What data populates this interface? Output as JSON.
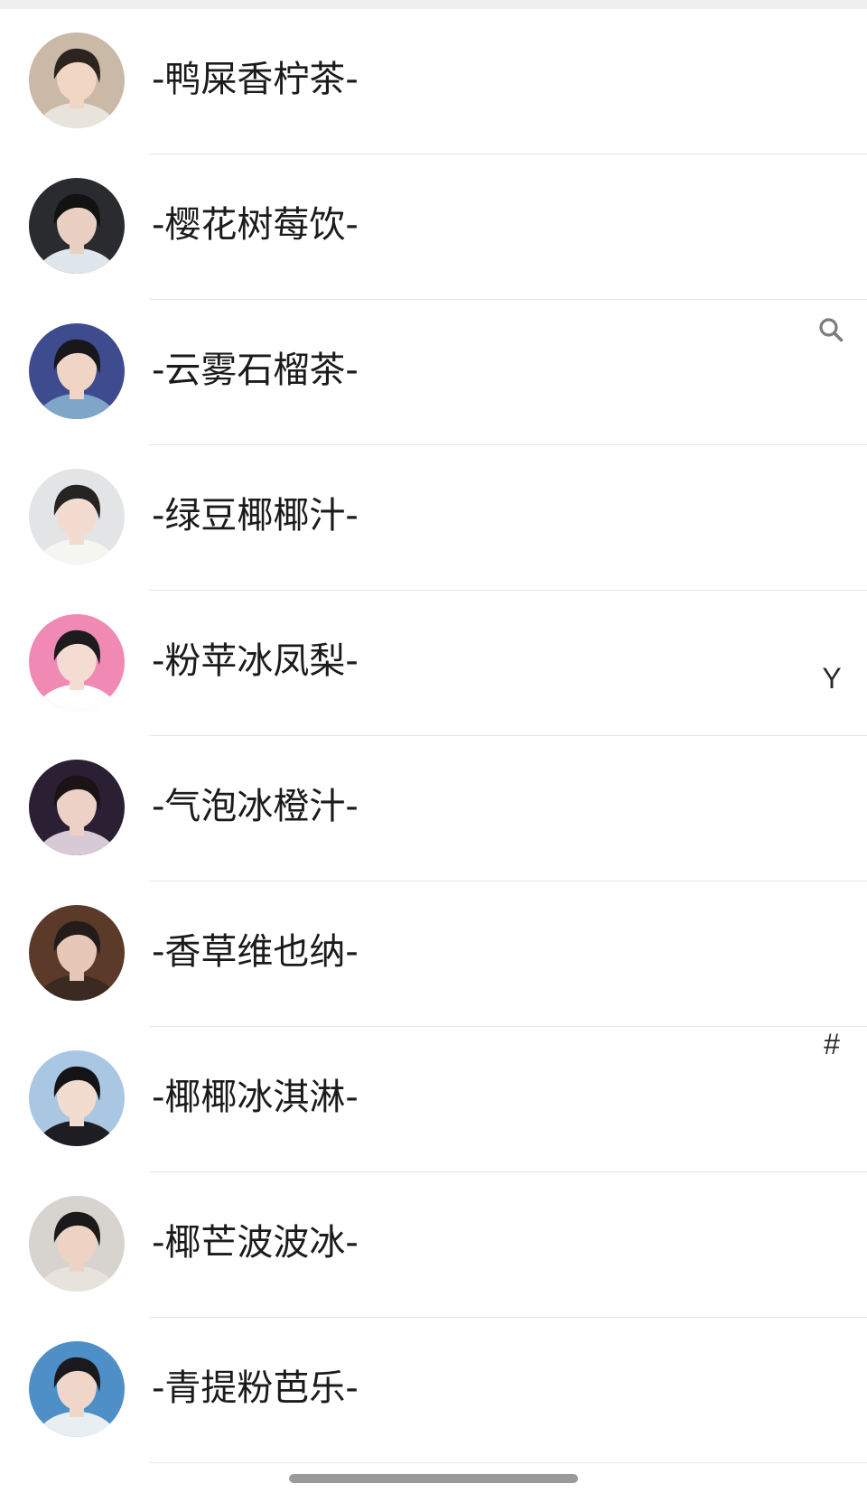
{
  "contacts": [
    {
      "name": "-鸭屎香柠茶-",
      "avatar": {
        "bg": "#c9b9a6",
        "hair": "#2e241f",
        "skin": "#f1d6c4",
        "shirt": "#e8e4dc"
      }
    },
    {
      "name": "-樱花树莓饮-",
      "avatar": {
        "bg": "#2a2b2e",
        "hair": "#121212",
        "skin": "#e9d0c2",
        "shirt": "#dfe7ec"
      }
    },
    {
      "name": "-云雾石榴茶-",
      "avatar": {
        "bg": "#3e4c8f",
        "hair": "#17171c",
        "skin": "#f0d4c6",
        "shirt": "#7fa6c9"
      }
    },
    {
      "name": "-绿豆椰椰汁-",
      "avatar": {
        "bg": "#e3e4e6",
        "hair": "#262323",
        "skin": "#f3dccf",
        "shirt": "#f5f5f2"
      }
    },
    {
      "name": "-粉苹冰凤梨-",
      "avatar": {
        "bg": "#f08ab4",
        "hair": "#1c1b1d",
        "skin": "#f5dcd2",
        "shirt": "#ffffff"
      }
    },
    {
      "name": "-气泡冰橙汁-",
      "avatar": {
        "bg": "#2a1f33",
        "hair": "#1a1416",
        "skin": "#eed1c6",
        "shirt": "#d8c9d6"
      }
    },
    {
      "name": "-香草维也纳-",
      "avatar": {
        "bg": "#5b3a2a",
        "hair": "#241c18",
        "skin": "#e7c7b7",
        "shirt": "#3b2a22"
      }
    },
    {
      "name": "-椰椰冰淇淋-",
      "avatar": {
        "bg": "#a9c7e3",
        "hair": "#141416",
        "skin": "#f2dbcf",
        "shirt": "#1e1e22"
      }
    },
    {
      "name": "-椰芒波波冰-",
      "avatar": {
        "bg": "#d7d3cf",
        "hair": "#1b1a1a",
        "skin": "#eed3c5",
        "shirt": "#e8e2dc"
      }
    },
    {
      "name": "-青提粉芭乐-",
      "avatar": {
        "bg": "#4f8fc7",
        "hair": "#1a1a1e",
        "skin": "#f0d6c9",
        "shirt": "#e9eef3"
      }
    }
  ],
  "index_bar": {
    "search_icon": "search-icon",
    "letters": {
      "y": "Y",
      "hash": "#"
    }
  },
  "colors": {
    "text": "#1b1b1b",
    "divider": "#e6e6e6",
    "index_text": "#2a2a2a",
    "home_indicator": "#9a9a9a"
  }
}
